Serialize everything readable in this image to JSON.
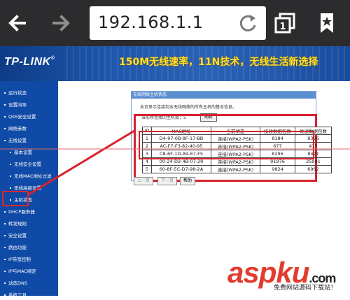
{
  "browser": {
    "url": "192.168.1.1",
    "tab_count": "1",
    "icons": [
      "back-arrow-icon",
      "forward-arrow-icon",
      "reload-icon",
      "tabs-icon",
      "bookmark-star-icon"
    ]
  },
  "banner": {
    "logo": "TP-LINK",
    "logo_mark": "®",
    "slogan": "150M无线速率，11N技术，无线生活新选择"
  },
  "sidebar": {
    "items": [
      {
        "label": "运行状态",
        "sub": false
      },
      {
        "label": "设置向导",
        "sub": false
      },
      {
        "label": "QSS安全设置",
        "sub": false
      },
      {
        "label": "网络参数",
        "sub": false
      },
      {
        "label": "无线设置",
        "sub": false
      },
      {
        "label": "基本设置",
        "sub": true
      },
      {
        "label": "无线安全设置",
        "sub": true
      },
      {
        "label": "无线MAC地址过滤",
        "sub": true
      },
      {
        "label": "无线高级设置",
        "sub": true
      },
      {
        "label": "主机状态",
        "sub": true
      },
      {
        "label": "DHCP服务器",
        "sub": false
      },
      {
        "label": "转发规则",
        "sub": false
      },
      {
        "label": "安全设置",
        "sub": false
      },
      {
        "label": "路由功能",
        "sub": false
      },
      {
        "label": "IP带宽控制",
        "sub": false
      },
      {
        "label": "IP与MAC绑定",
        "sub": false
      },
      {
        "label": "动态DNS",
        "sub": false
      },
      {
        "label": "系统工具",
        "sub": false
      }
    ]
  },
  "panel": {
    "title": "无线网络主机状态",
    "description": "本页显示连接到本无线网络的所有主机的基本信息。",
    "count_label": "当前所连接的主机数：5",
    "refresh_label": "刷新",
    "prev_label": "上一页",
    "next_label": "下一页",
    "help_label": "帮助"
  },
  "hosts_table": {
    "headers": [
      "ID",
      "MAC地址",
      "当前状态",
      "接收数据包数",
      "发送数据包数"
    ],
    "rows": [
      [
        "1",
        "D4-97-0B-8F-17-BB",
        "连接(WPA2-PSK)",
        "8184",
        "8326"
      ],
      [
        "2",
        "AC-F7-F3-82-40-95",
        "连接(WPA2-PSK)",
        "677",
        "437"
      ],
      [
        "3",
        "C8-6F-1D-A9-67-F5",
        "连接(WPA2-PSK)",
        "8296",
        "8421"
      ],
      [
        "4",
        "00-24-D2-4B-07-29",
        "连接(WPA2-PSK)",
        "91976",
        "25991"
      ],
      [
        "5",
        "60-8F-5C-D7-98-2A",
        "连接(WPA2-PSK)",
        "9824",
        "6962"
      ]
    ]
  },
  "watermark": {
    "brand": "aspku",
    "brand_suffix": ".com",
    "tagline": "免费网站源码下载站！"
  },
  "colors": {
    "toolbar": "#2c2c2e",
    "sidebar": "#0f4aa6",
    "annotation_red": "#d7232d",
    "slogan_yellow": "#ffde2a"
  }
}
